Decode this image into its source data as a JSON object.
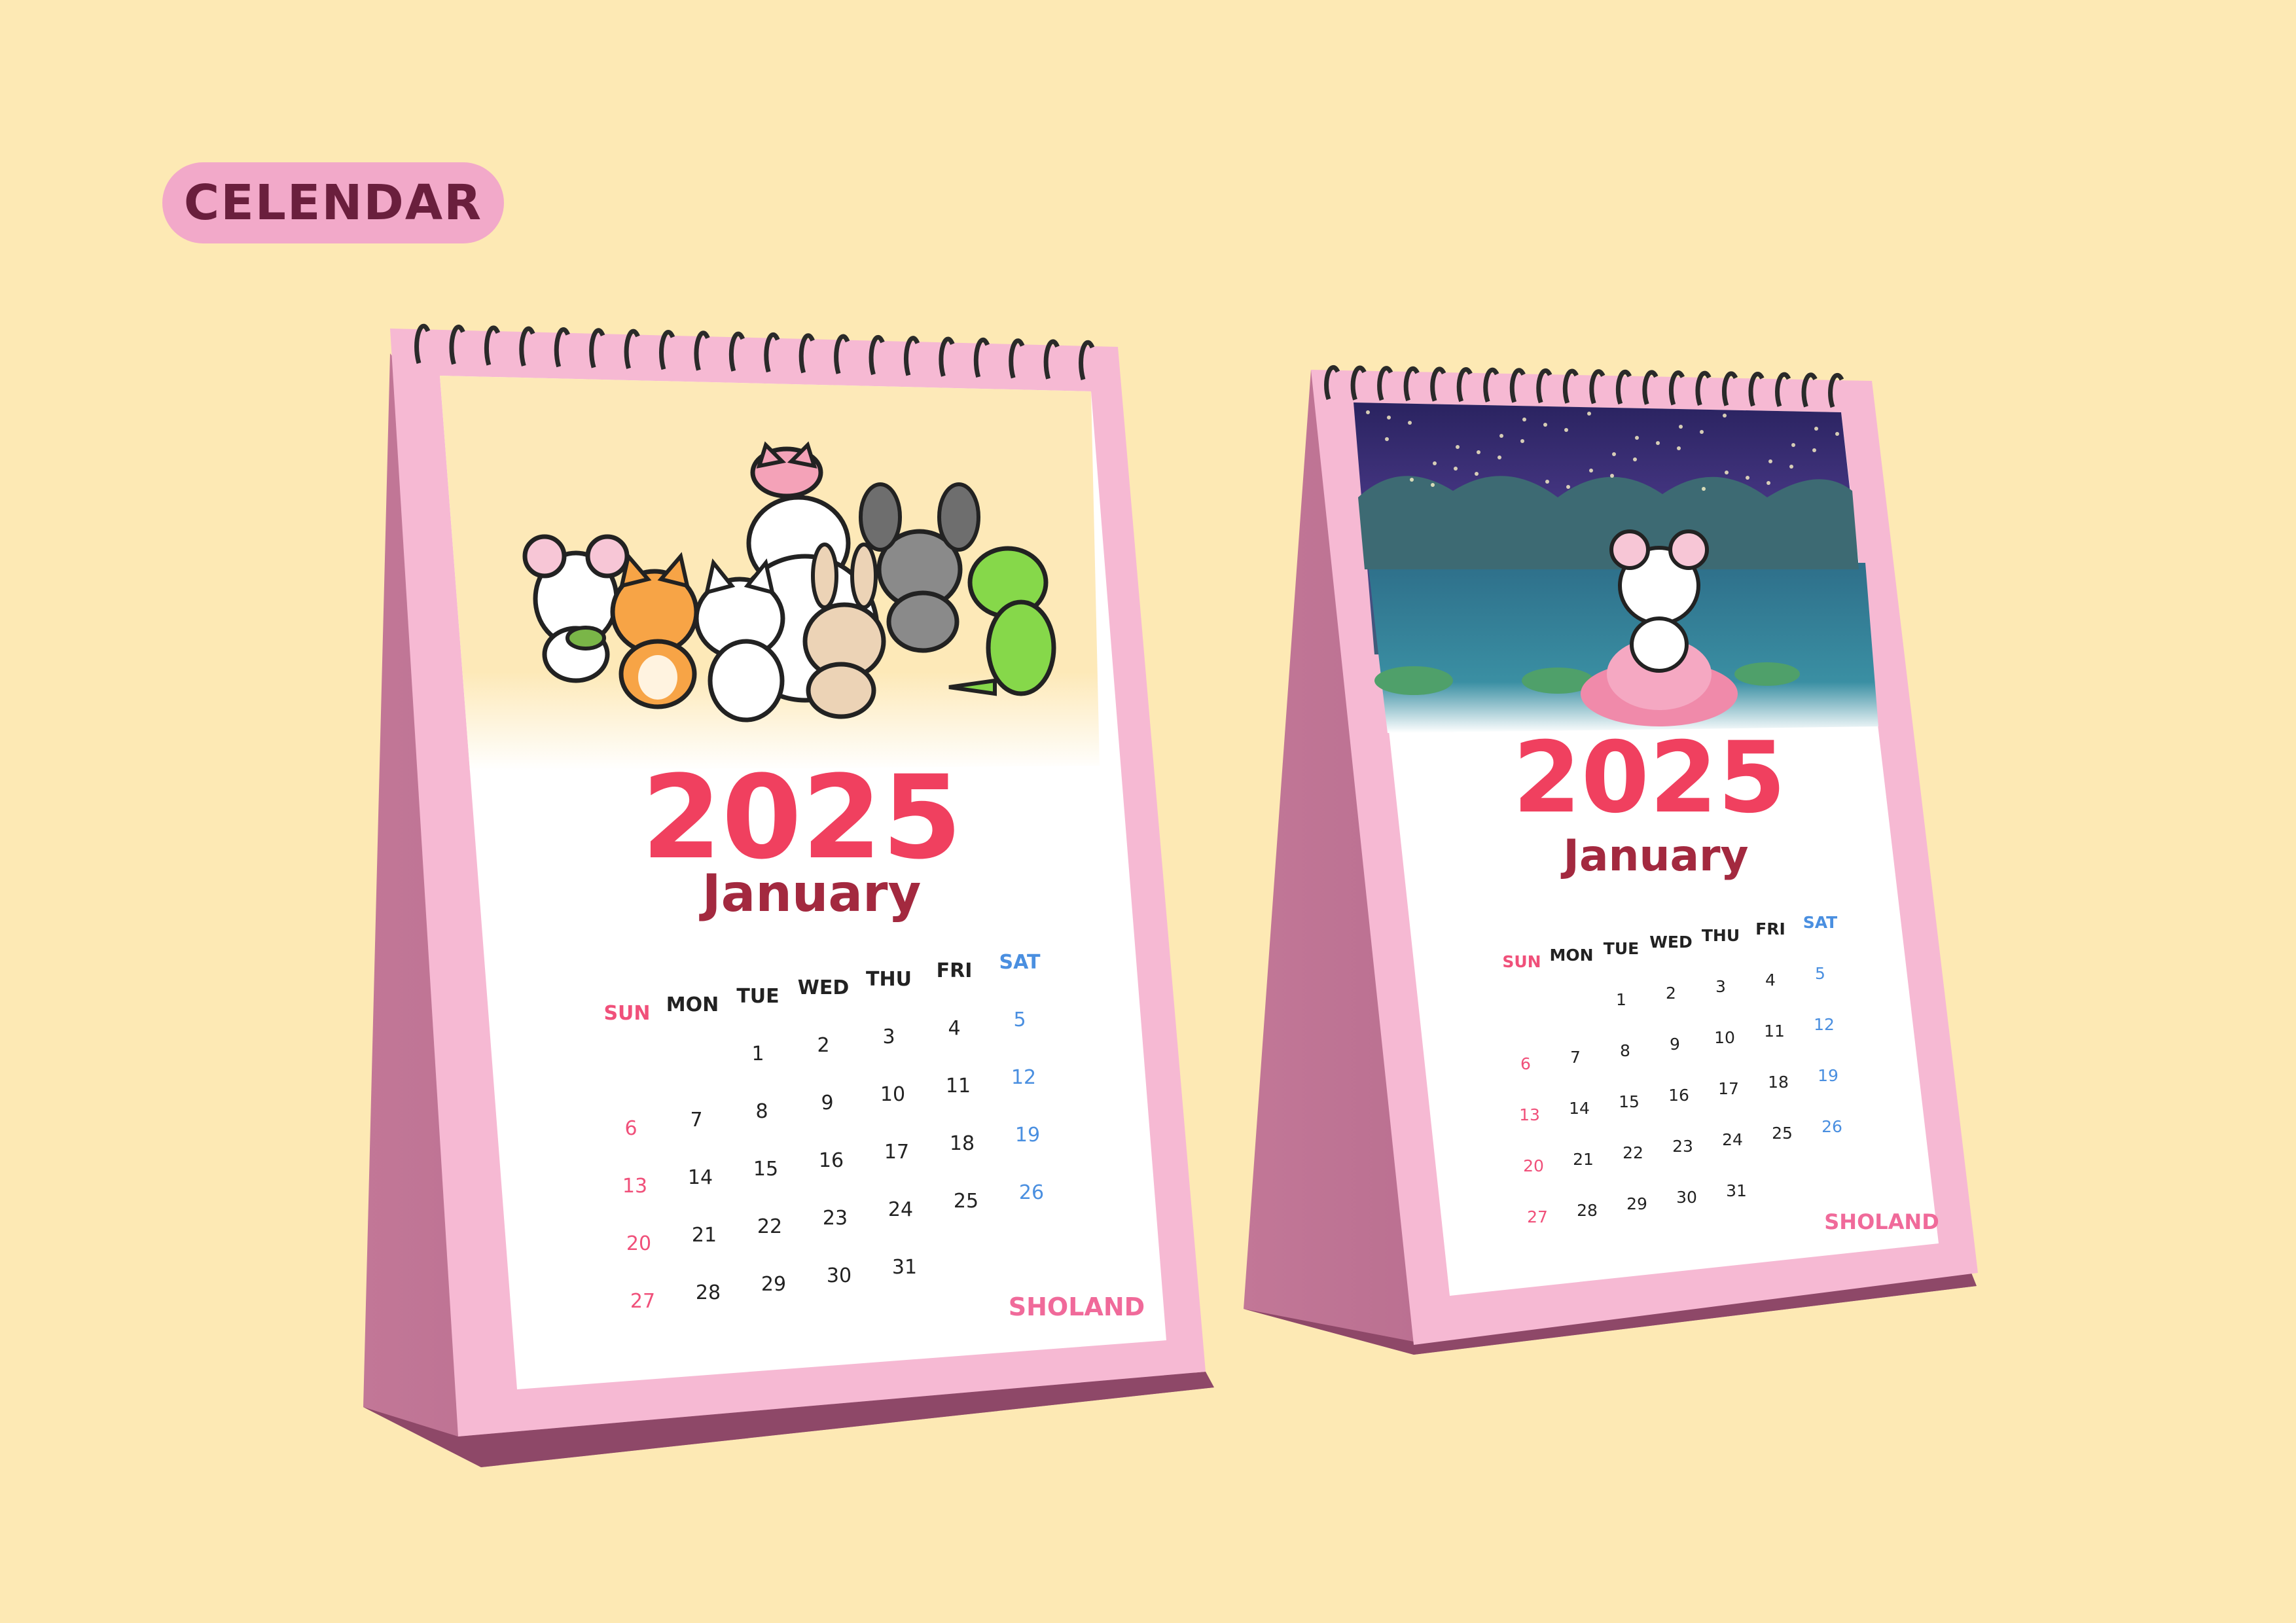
{
  "badge": {
    "label": "CELENDAR"
  },
  "colors": {
    "background": "#fde9b4",
    "badge_bg": "#f2a9c9",
    "stand": "#b56b8d",
    "stand_dark": "#9e5479",
    "frame": "#f6b9d3",
    "year": "#f0405f",
    "month": "#a3293f",
    "sunday": "#f0507a",
    "saturday": "#4a8fe0",
    "weekday": "#222222",
    "brand": "#f06a9a"
  },
  "calendars": [
    {
      "year": "2025",
      "month": "January",
      "brand": "SHOLAND",
      "illustration": "cute-animal-group-illustration",
      "weekdays": [
        "SUN",
        "MON",
        "TUE",
        "WED",
        "THU",
        "FRI",
        "SAT"
      ],
      "weeks": [
        [
          "",
          "",
          "1",
          "2",
          "3",
          "4",
          "5"
        ],
        [
          "6",
          "7",
          "8",
          "9",
          "10",
          "11",
          "12"
        ],
        [
          "13",
          "14",
          "15",
          "16",
          "17",
          "18",
          "19"
        ],
        [
          "20",
          "21",
          "22",
          "23",
          "24",
          "25",
          "26"
        ],
        [
          "27",
          "28",
          "29",
          "30",
          "31",
          "",
          ""
        ]
      ]
    },
    {
      "year": "2025",
      "month": "January",
      "brand": "SHOLAND",
      "illustration": "mouse-on-lotus-night-pond-illustration",
      "weekdays": [
        "SUN",
        "MON",
        "TUE",
        "WED",
        "THU",
        "FRI",
        "SAT"
      ],
      "weeks": [
        [
          "",
          "",
          "1",
          "2",
          "3",
          "4",
          "5"
        ],
        [
          "6",
          "7",
          "8",
          "9",
          "10",
          "11",
          "12"
        ],
        [
          "13",
          "14",
          "15",
          "16",
          "17",
          "18",
          "19"
        ],
        [
          "20",
          "21",
          "22",
          "23",
          "24",
          "25",
          "26"
        ],
        [
          "27",
          "28",
          "29",
          "30",
          "31",
          "",
          ""
        ]
      ]
    }
  ]
}
